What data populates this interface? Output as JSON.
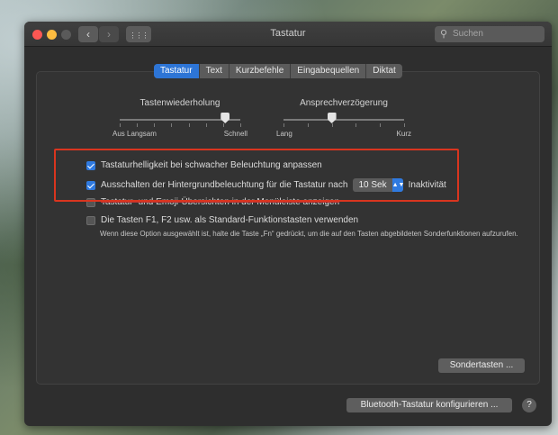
{
  "window": {
    "title": "Tastatur",
    "search_placeholder": "Suchen"
  },
  "toolbar": {
    "back_glyph": "‹",
    "forward_glyph": "›",
    "grid_glyph": "⋮⋮⋮"
  },
  "tabs": [
    {
      "label": "Tastatur",
      "active": true
    },
    {
      "label": "Text",
      "active": false
    },
    {
      "label": "Kurzbefehle",
      "active": false
    },
    {
      "label": "Eingabequellen",
      "active": false
    },
    {
      "label": "Diktat",
      "active": false
    }
  ],
  "sliders": {
    "key_repeat": {
      "title": "Tastenwiederholung",
      "left_label": "Aus Langsam",
      "right_label": "Schnell",
      "value_fraction": 0.875
    },
    "repeat_delay": {
      "title": "Ansprechverzögerung",
      "left_label": "Lang",
      "right_label": "Kurz",
      "value_fraction": 0.4
    }
  },
  "options": {
    "auto_brightness": {
      "label": "Tastaturhelligkeit bei schwacher Beleuchtung anpassen",
      "checked": true
    },
    "backlight_off": {
      "label": "Ausschalten der Hintergrundbeleuchtung für die Tastatur nach",
      "checked": true,
      "select_value": "10 Sek",
      "suffix": "Inaktivität"
    },
    "emoji_viewer": {
      "label": "Tastatur- und Emoji-Übersichten in der Menüleiste anzeigen",
      "checked": false
    },
    "fn_keys": {
      "label": "Die Tasten F1, F2 usw. als Standard-Funktionstasten verwenden",
      "checked": false
    },
    "fn_hint": "Wenn diese Option ausgewählt ist, halte die Taste „Fn“ gedrückt, um die auf den Tasten abgebildeten Sonderfunktionen aufzurufen."
  },
  "buttons": {
    "modifier_keys": "Sondertasten ...",
    "bluetooth": "Bluetooth-Tastatur konfigurieren ...",
    "help": "?"
  },
  "colors": {
    "accent": "#2f7ae0",
    "highlight_box": "#d9351f"
  }
}
